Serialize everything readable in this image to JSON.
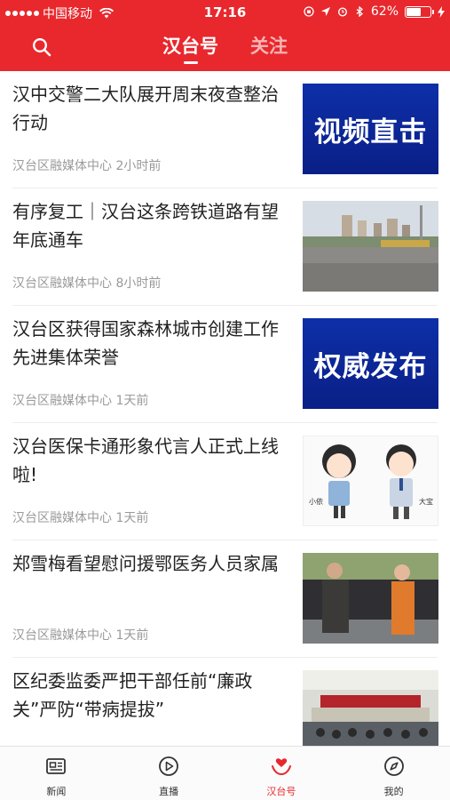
{
  "status_bar": {
    "carrier": "中国移动",
    "time": "17:16",
    "battery_percent": "62%",
    "battery_level": 0.62
  },
  "header": {
    "tabs": [
      {
        "label": "汉台号",
        "active": true
      },
      {
        "label": "关注",
        "active": false
      }
    ],
    "accent_color": "#e8282d"
  },
  "feed": {
    "items": [
      {
        "title": "汉中交警二大队展开周末夜查整治行动",
        "source": "汉台区融媒体中心",
        "time": "2小时前",
        "thumb_text": "视频直击",
        "thumb_kind": "banner"
      },
      {
        "title": "有序复工｜汉台这条跨铁道路有望年底通车",
        "source": "汉台区融媒体中心",
        "time": "8小时前",
        "thumb_kind": "photo-buildings"
      },
      {
        "title": "汉台区获得国家森林城市创建工作先进集体荣誉",
        "source": "汉台区融媒体中心",
        "time": "1天前",
        "thumb_text": "权威发布",
        "thumb_kind": "banner"
      },
      {
        "title": "汉台医保卡通形象代言人正式上线啦!",
        "source": "汉台区融媒体中心",
        "time": "1天前",
        "thumb_kind": "cartoon",
        "thumb_labels": [
          "小依",
          "大宝"
        ]
      },
      {
        "title": "郑雪梅看望慰问援鄂医务人员家属",
        "source": "汉台区融媒体中心",
        "time": "1天前",
        "thumb_kind": "photo-people"
      },
      {
        "title": "区纪委监委严把干部任前“廉政关”严防“带病提拔”",
        "source": "",
        "time": "",
        "thumb_kind": "photo-meeting"
      }
    ]
  },
  "tabbar": {
    "items": [
      {
        "label": "新闻",
        "icon": "newspaper-icon",
        "active": false
      },
      {
        "label": "直播",
        "icon": "play-circle-icon",
        "active": false
      },
      {
        "label": "汉台号",
        "icon": "heart-hands-icon",
        "active": true
      },
      {
        "label": "我的",
        "icon": "compass-icon",
        "active": false
      }
    ]
  }
}
